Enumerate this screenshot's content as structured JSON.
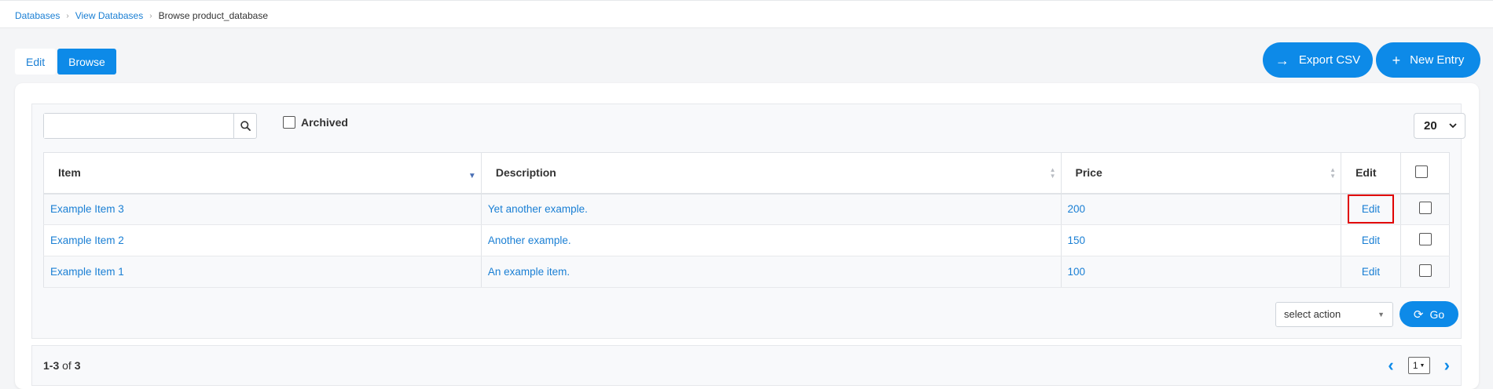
{
  "breadcrumb": {
    "items": [
      "Databases",
      "View Databases"
    ],
    "current": "Browse product_database"
  },
  "mode_tabs": {
    "edit": "Edit",
    "browse": "Browse"
  },
  "actions": {
    "export_label": "Export CSV",
    "new_entry_label": "New Entry"
  },
  "toolbar": {
    "search_placeholder": "",
    "archived_label": "Archived",
    "per_page": "20"
  },
  "table": {
    "headers": {
      "item": "Item",
      "description": "Description",
      "price": "Price",
      "edit": "Edit"
    },
    "rows": [
      {
        "item": "Example Item 3",
        "description": "Yet another example.",
        "price": "200",
        "edit": "Edit"
      },
      {
        "item": "Example Item 2",
        "description": "Another example.",
        "price": "150",
        "edit": "Edit"
      },
      {
        "item": "Example Item 1",
        "description": "An example item.",
        "price": "100",
        "edit": "Edit"
      }
    ]
  },
  "bulk": {
    "select_label": "select action",
    "go_label": "Go"
  },
  "footer": {
    "range": "1-3",
    "of_text": "of",
    "total": "3",
    "page": "1"
  },
  "colors": {
    "accent": "#0d8ae8",
    "link": "#1a7fd4",
    "highlight": "#e00000"
  }
}
